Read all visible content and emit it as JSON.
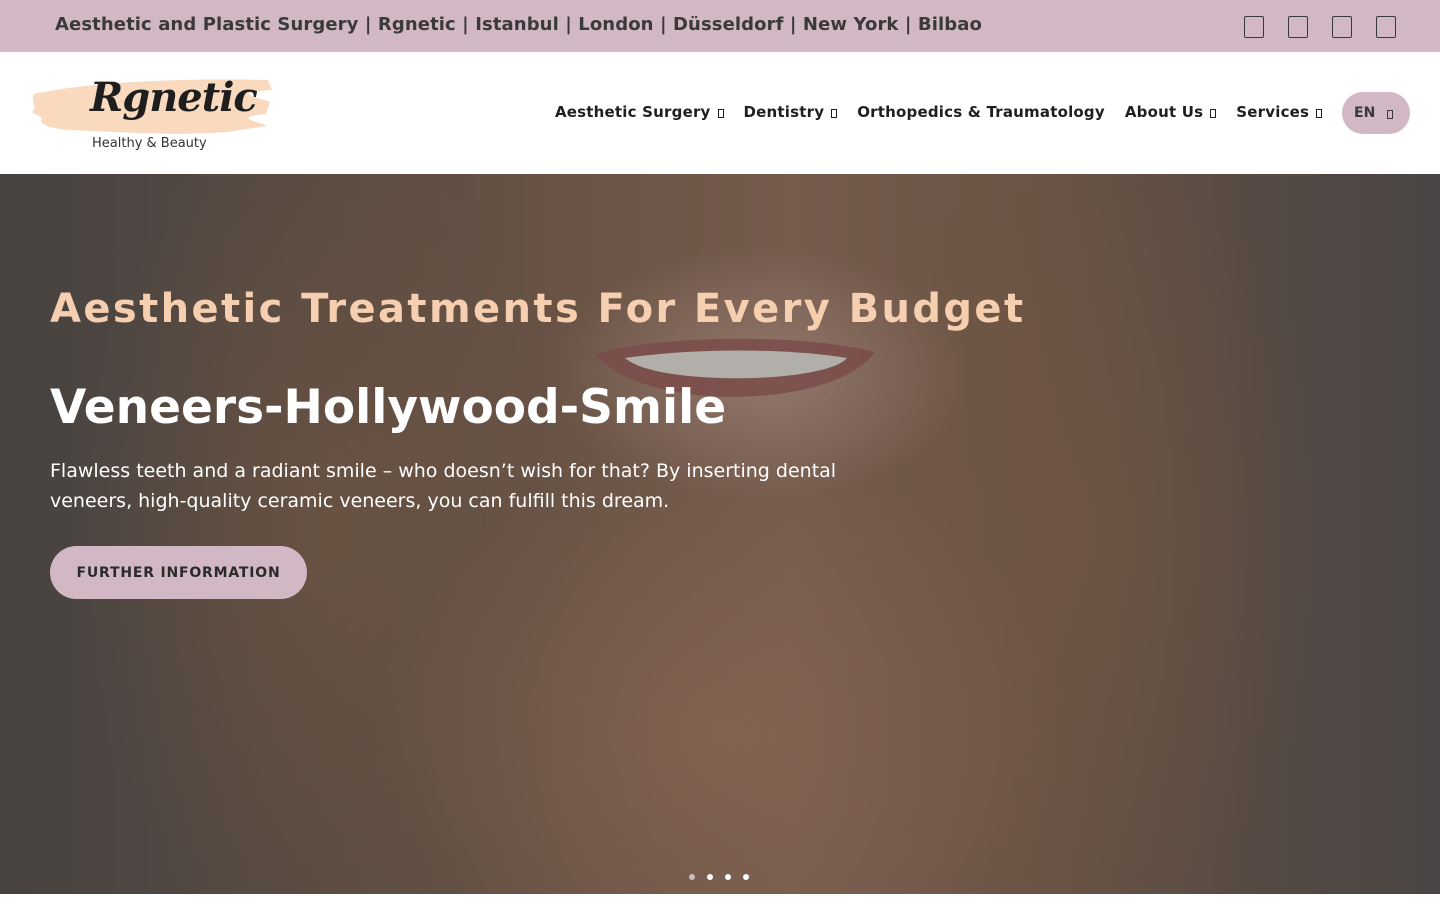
{
  "topbar": {
    "title": "Aesthetic and Plastic Surgery | Rgnetic | Istanbul | London | Düsseldorf | New York | Bilbao",
    "icons": [
      "social-icon-1",
      "social-icon-2",
      "social-icon-3",
      "social-icon-4"
    ]
  },
  "header": {
    "logo": {
      "name": "Rgnetic",
      "tagline": "Healthy & Beauty"
    },
    "nav": [
      {
        "label": "Aesthetic Surgery",
        "has_dropdown": true
      },
      {
        "label": "Dentistry",
        "has_dropdown": true
      },
      {
        "label": "Orthopedics & Traumatology",
        "has_dropdown": false
      },
      {
        "label": "About Us",
        "has_dropdown": true
      },
      {
        "label": "Services",
        "has_dropdown": true
      }
    ],
    "language": "EN"
  },
  "hero": {
    "eyebrow": "Aesthetic Treatments For Every Budget",
    "title": "Veneers-Hollywood-Smile",
    "description": "Flawless teeth and a radiant smile – who doesn’t wish for that? By inserting dental veneers, high-quality ceramic veneers, you can fulfill this dream.",
    "button_label": "FURTHER INFORMATION",
    "slides_total": 4,
    "active_slide": 1
  },
  "colors": {
    "accent": "#d2b8c4",
    "eyebrow": "#f6cfb0",
    "logo_brush": "#f8d6b8"
  }
}
